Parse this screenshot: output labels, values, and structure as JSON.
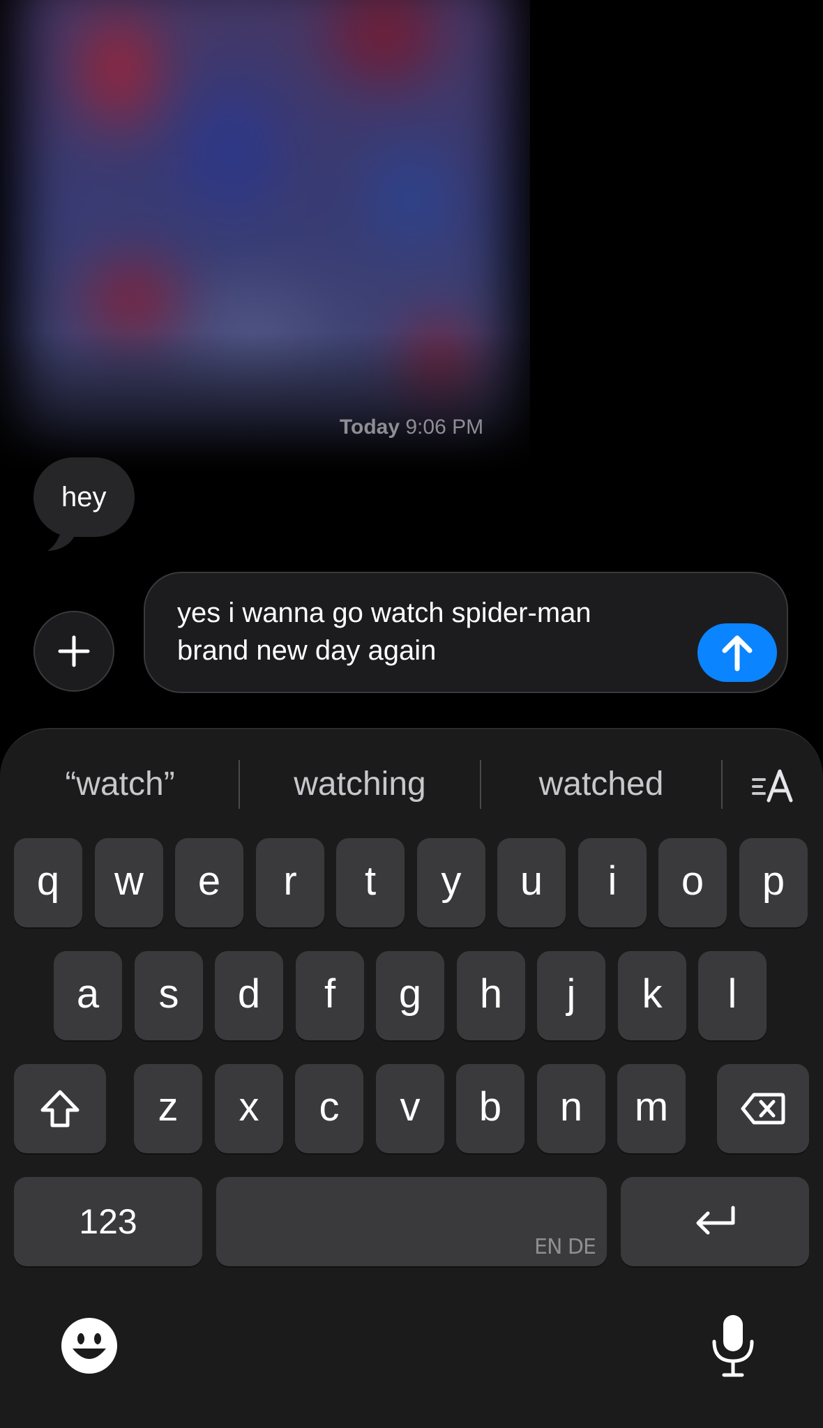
{
  "thread": {
    "timestamp_day": "Today",
    "timestamp_time": "9:06 PM",
    "received_message": "hey"
  },
  "compose": {
    "text": "yes i wanna go watch spider-man\nbrand new day again",
    "accent_color": "#0a84ff"
  },
  "keyboard": {
    "suggestions": [
      "“watch”",
      "watching",
      "watched"
    ],
    "rows": [
      [
        "q",
        "w",
        "e",
        "r",
        "t",
        "y",
        "u",
        "i",
        "o",
        "p"
      ],
      [
        "a",
        "s",
        "d",
        "f",
        "g",
        "h",
        "j",
        "k",
        "l"
      ],
      [
        "z",
        "x",
        "c",
        "v",
        "b",
        "n",
        "m"
      ]
    ],
    "numbers_label": "123",
    "space_languages": "EN DE",
    "icons": {
      "shift": "shift-icon",
      "delete": "delete-backspace-icon",
      "return": "return-icon",
      "emoji": "emoji-icon",
      "dictation": "microphone-icon",
      "text_format": "text-format-icon"
    }
  }
}
